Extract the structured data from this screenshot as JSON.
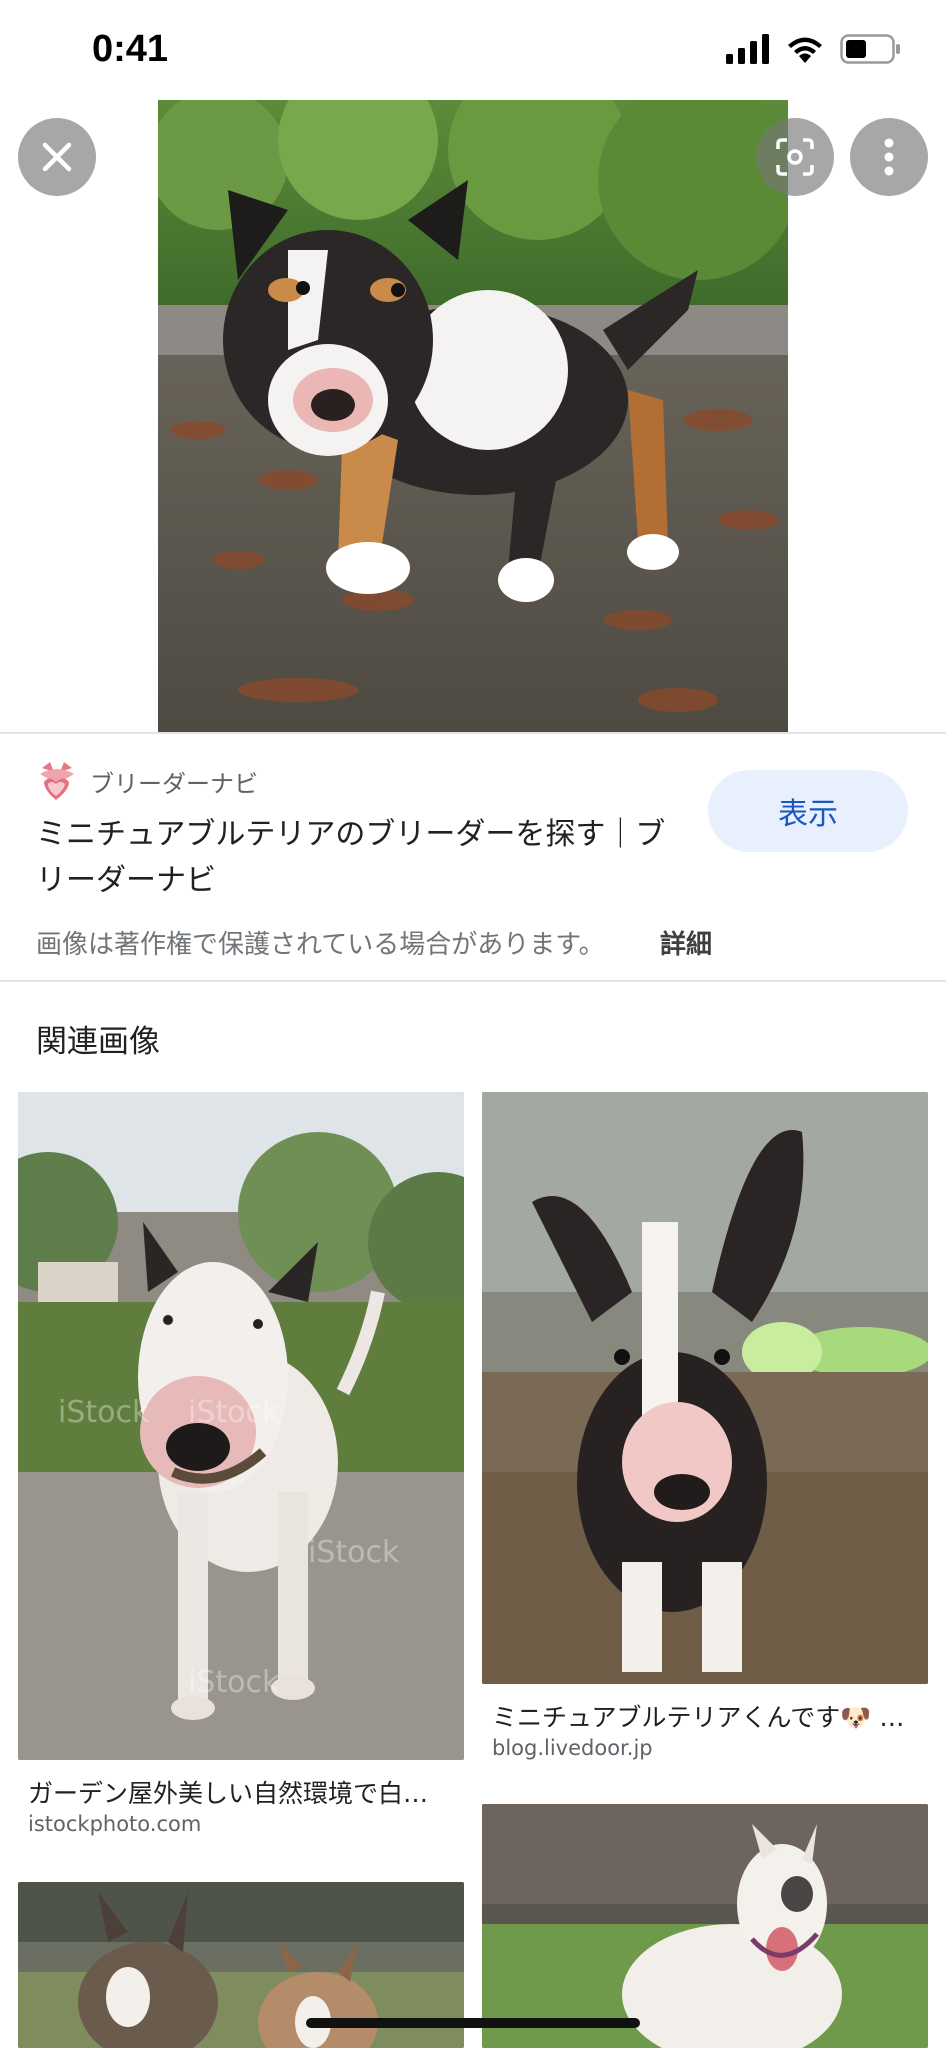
{
  "status_bar": {
    "time": "0:41"
  },
  "source": {
    "name": "ブリーダーナビ",
    "title": "ミニチュアブルテリアのブリーダーを探す｜ブリーダーナビ",
    "view_button": "表示"
  },
  "notice": {
    "copyright": "画像は著作権で保護されている場合があります。",
    "details": "詳細"
  },
  "related": {
    "heading": "関連画像",
    "items": [
      {
        "caption": "ガーデン屋外美しい自然環境で白…",
        "domain": "istockphoto.com",
        "watermark": "iStock"
      },
      {
        "caption": "ミニチュアブルテリアくんです🐶 …",
        "domain": "blog.livedoor.jp"
      }
    ]
  },
  "icons": {
    "close": "close-icon",
    "lens": "lens-icon",
    "more": "more-vert-icon"
  }
}
